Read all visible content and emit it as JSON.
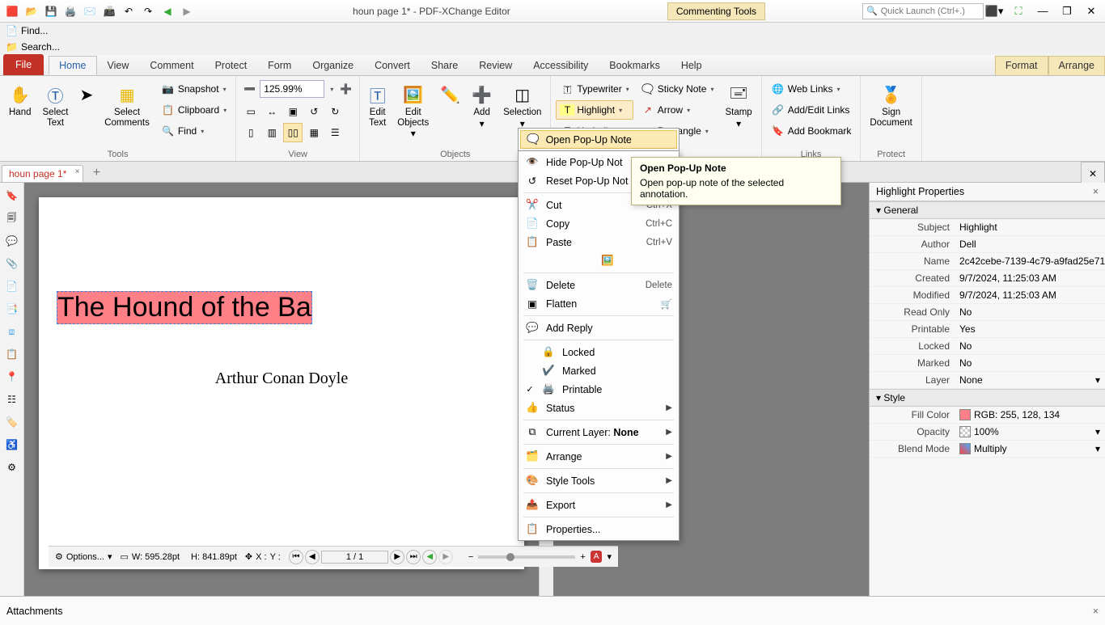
{
  "window": {
    "title": "houn page 1* - PDF-XChange Editor",
    "context_tab": "Commenting Tools",
    "quick_launch_placeholder": "Quick Launch (Ctrl+.)",
    "find_label": "Find...",
    "search_label": "Search..."
  },
  "tabs": {
    "file": "File",
    "items": [
      "Home",
      "View",
      "Comment",
      "Protect",
      "Form",
      "Organize",
      "Convert",
      "Share",
      "Review",
      "Accessibility",
      "Bookmarks",
      "Help"
    ],
    "context": [
      "Format",
      "Arrange"
    ],
    "active": "Home"
  },
  "ribbon": {
    "tools": {
      "label": "Tools",
      "hand": "Hand",
      "select_text": "Select\nText",
      "select_comments": "Select\nComments",
      "snapshot": "Snapshot",
      "clipboard": "Clipboard",
      "find": "Find"
    },
    "view": {
      "label": "View",
      "zoom": "125.99%"
    },
    "objects": {
      "label": "Objects",
      "edit_text": "Edit\nText",
      "edit_objects": "Edit\nObjects",
      "add": "Add",
      "selection": "Selection"
    },
    "comment": {
      "highlight": "Highlight",
      "underline": "Underline",
      "typewriter": "Typewriter",
      "sticky": "Sticky Note",
      "arrow": "Arrow",
      "rectangle": "Rectangle",
      "stamp": "Stamp"
    },
    "links": {
      "label": "Links",
      "web": "Web Links",
      "addedit": "Add/Edit Links",
      "bookmark": "Add Bookmark"
    },
    "protect": {
      "label": "Protect",
      "sign": "Sign\nDocument"
    }
  },
  "doc_tabs": {
    "tab1": "houn page 1*"
  },
  "page": {
    "title_text": "The Hound of the Ba",
    "author": "Arthur Conan Doyle"
  },
  "ctx": {
    "open": "Open Pop-Up Note",
    "hide": "Hide Pop-Up Not",
    "reset": "Reset Pop-Up Not",
    "cut": "Cut",
    "cut_sc": "Ctrl+X",
    "copy": "Copy",
    "copy_sc": "Ctrl+C",
    "paste": "Paste",
    "paste_sc": "Ctrl+V",
    "delete": "Delete",
    "delete_sc": "Delete",
    "flatten": "Flatten",
    "addreply": "Add Reply",
    "locked": "Locked",
    "marked": "Marked",
    "printable": "Printable",
    "status": "Status",
    "layer_pre": "Current Layer: ",
    "layer_val": "None",
    "arrange": "Arrange",
    "styletools": "Style Tools",
    "export": "Export",
    "properties": "Properties..."
  },
  "tooltip": {
    "title": "Open Pop-Up Note",
    "body": "Open pop-up note of the selected annotation."
  },
  "props": {
    "panel_title": "Highlight Properties",
    "general": "General",
    "style": "Style",
    "rows": {
      "subject_k": "Subject",
      "subject_v": "Highlight",
      "author_k": "Author",
      "author_v": "Dell",
      "name_k": "Name",
      "name_v": "2c42cebe-7139-4c79-a9fad25e71..",
      "created_k": "Created",
      "created_v": "9/7/2024, 11:25:03 AM",
      "modified_k": "Modified",
      "modified_v": "9/7/2024, 11:25:03 AM",
      "readonly_k": "Read Only",
      "readonly_v": "No",
      "printable_k": "Printable",
      "printable_v": "Yes",
      "locked_k": "Locked",
      "locked_v": "No",
      "marked_k": "Marked",
      "marked_v": "No",
      "layer_k": "Layer",
      "layer_v": "None",
      "fill_k": "Fill Color",
      "fill_v": "RGB: 255, 128, 134",
      "opacity_k": "Opacity",
      "opacity_v": "100%",
      "blend_k": "Blend Mode",
      "blend_v": "Multiply"
    },
    "fill_hex": "#ff8086"
  },
  "status": {
    "options": "Options...",
    "w": "W: 595.28pt",
    "h": "H: 841.89pt",
    "x": "X :",
    "y": "Y :",
    "page": "1 / 1"
  },
  "attachments": {
    "title": "Attachments"
  }
}
